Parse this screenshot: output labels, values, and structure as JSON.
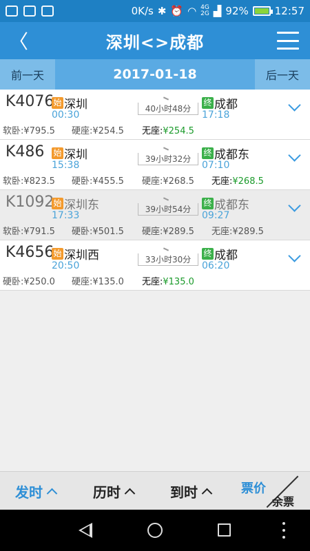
{
  "status_bar": {
    "net_speed": "0K/s",
    "network_top": "4G",
    "network_bottom": "2G",
    "battery_percent": "92%",
    "battery_level": 0.92,
    "time": "12:57",
    "left_icons": [
      "cloud-icon",
      "message-icon",
      "image-icon"
    ],
    "right_icons": [
      "bluetooth-icon",
      "alarm-icon",
      "wifi-icon",
      "signal-icon",
      "battery-icon"
    ]
  },
  "header": {
    "title": "深圳<>成都",
    "back_icon": "chevron-left-icon",
    "menu_icon": "menu-icon"
  },
  "date_bar": {
    "prev_label": "前一天",
    "date": "2017-01-18",
    "next_label": "后一天"
  },
  "trains": [
    {
      "no": "K4076",
      "from_tag": "始",
      "from": "深圳",
      "dep": "00:30",
      "duration": "40小时48分",
      "to_tag": "终",
      "to": "成都",
      "arr": "17:18",
      "seats": [
        {
          "label": "软卧:",
          "price": "¥795.5"
        },
        {
          "label": "硬座:",
          "price": "¥254.5"
        },
        {
          "label": "无座:",
          "price": "¥254.5"
        }
      ],
      "disabled": false
    },
    {
      "no": "K486",
      "from_tag": "始",
      "from": "深圳",
      "dep": "15:38",
      "duration": "39小时32分",
      "to_tag": "终",
      "to": "成都东",
      "arr": "07:10",
      "seats": [
        {
          "label": "软卧:",
          "price": "¥823.5"
        },
        {
          "label": "硬卧:",
          "price": "¥455.5"
        },
        {
          "label": "硬座:",
          "price": "¥268.5"
        },
        {
          "label": "无座:",
          "price": "¥268.5"
        }
      ],
      "disabled": false
    },
    {
      "no": "K1092",
      "from_tag": "始",
      "from": "深圳东",
      "dep": "17:33",
      "duration": "39小时54分",
      "to_tag": "终",
      "to": "成都东",
      "arr": "09:27",
      "seats": [
        {
          "label": "软卧:",
          "price": "¥791.5"
        },
        {
          "label": "硬卧:",
          "price": "¥501.5"
        },
        {
          "label": "硬座:",
          "price": "¥289.5"
        },
        {
          "label": "无座:",
          "price": "¥289.5"
        }
      ],
      "disabled": true
    },
    {
      "no": "K4656",
      "from_tag": "始",
      "from": "深圳西",
      "dep": "20:50",
      "duration": "33小时30分",
      "to_tag": "终",
      "to": "成都",
      "arr": "06:20",
      "seats": [
        {
          "label": "硬卧:",
          "price": "¥250.0"
        },
        {
          "label": "硬座:",
          "price": "¥135.0"
        },
        {
          "label": "无座:",
          "price": "¥135.0"
        }
      ],
      "disabled": false
    }
  ],
  "sort_bar": {
    "depart_label": "发时",
    "duration_label": "历时",
    "arrive_label": "到时",
    "price_label": "票价",
    "remain_label": "余票"
  },
  "colors": {
    "primary": "#2e8fd6",
    "start_tag": "#f39a2d",
    "end_tag": "#3bb04a",
    "highlight_price": "#1a9a2a"
  }
}
